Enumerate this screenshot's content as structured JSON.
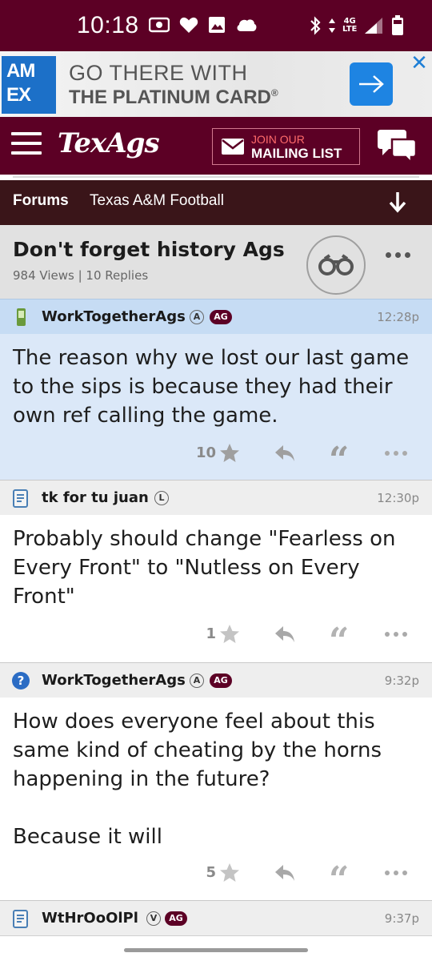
{
  "status_bar": {
    "time": "10:18",
    "network": "4G",
    "network_sub": "LTE"
  },
  "ad": {
    "brand_line1": "AM",
    "brand_line2": "EX",
    "headline": "GO THERE WITH",
    "subline": "THE PLATINUM CARD",
    "registered": "®"
  },
  "header": {
    "logo": "TexAgs",
    "mailing_top": "JOIN OUR",
    "mailing_bottom": "MAILING LIST"
  },
  "breadcrumb": {
    "forums": "Forums",
    "section": "Texas A&M Football"
  },
  "thread": {
    "title": "Don't forget history Ags",
    "meta": "984 Views | 10 Replies"
  },
  "posts": [
    {
      "user": "WorkTogetherAgs",
      "badge": "A",
      "ag": "AG",
      "time": "12:28p",
      "text": "The reason why we lost our last game to the sips is because they had their own ref calling the game.",
      "stars": "10"
    },
    {
      "user": "tk for tu juan",
      "badge": "L",
      "time": "12:30p",
      "text": "Probably should change \"Fearless on Every Front\" to \"Nutless on Every Front\"",
      "stars": "1"
    },
    {
      "user": "WorkTogetherAgs",
      "badge": "A",
      "ag": "AG",
      "time": "9:32p",
      "text": "How does everyone feel about this same kind of cheating by the horns happening in the future?\n\nBecause it will",
      "stars": "5"
    },
    {
      "user": "WtHrOoOlPl",
      "badge": "V",
      "ag": "AG",
      "time": "9:37p"
    }
  ],
  "colors": {
    "maroon": "#5c0025",
    "breadcrumb_bg": "#3a1519",
    "highlight_post": "#dbe8f8",
    "amex_blue": "#1c70c8"
  }
}
